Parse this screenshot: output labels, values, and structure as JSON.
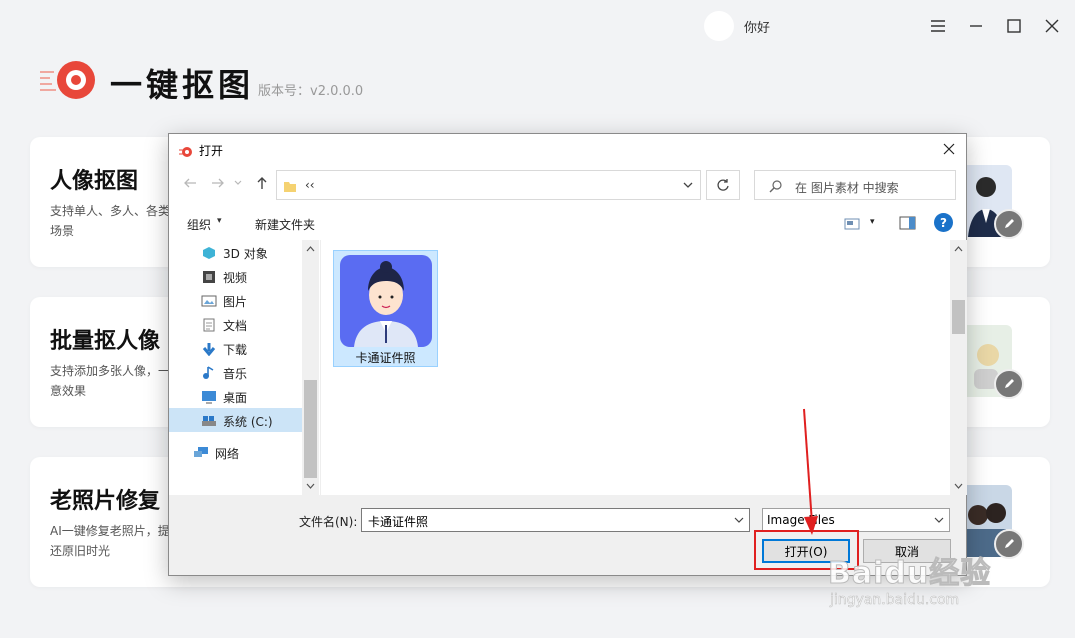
{
  "app": {
    "greeting": "你好",
    "brand_name": "一键抠图",
    "version": "版本号：v2.0.0.0",
    "cards": [
      {
        "title": "人像抠图",
        "desc": "支持单人、多人、各类场景"
      },
      {
        "title": "批量抠人像",
        "desc": "支持添加多张人像，一意效果"
      },
      {
        "title": "老照片修复",
        "desc": "AI一键修复老照片，提还原旧时光"
      }
    ]
  },
  "dialog": {
    "title": "打开",
    "address": "‹‹",
    "search_placeholder": "在 图片素材 中搜索",
    "toolbar": {
      "organize": "组织",
      "organize_caret": "▾",
      "new_folder": "新建文件夹",
      "view_caret": "▾",
      "help": "?"
    },
    "tree": [
      {
        "label": "3D 对象",
        "icon": "3d-objects-icon",
        "selected": false
      },
      {
        "label": "视频",
        "icon": "video-icon",
        "selected": false
      },
      {
        "label": "图片",
        "icon": "pictures-icon",
        "selected": false
      },
      {
        "label": "文档",
        "icon": "documents-icon",
        "selected": false
      },
      {
        "label": "下载",
        "icon": "download-icon",
        "selected": false
      },
      {
        "label": "音乐",
        "icon": "music-icon",
        "selected": false
      },
      {
        "label": "桌面",
        "icon": "desktop-icon",
        "selected": false
      },
      {
        "label": "系统 (C:)",
        "icon": "drive-icon",
        "selected": true
      },
      {
        "label": "网络",
        "icon": "network-icon",
        "selected": false
      }
    ],
    "files": [
      {
        "name": "卡通证件照",
        "selected": true
      }
    ],
    "filename_label": "文件名(N):",
    "filename_value": "卡通证件照",
    "filetype_value": "Image Files",
    "open_button": "打开(O)",
    "cancel_button": "取消"
  },
  "watermark": {
    "brand": "Baidu经验",
    "url": "jingyan.baidu.com"
  },
  "colors": {
    "accent": "#0078d7",
    "highlight": "#e02020",
    "brand_red": "#e8473a"
  }
}
